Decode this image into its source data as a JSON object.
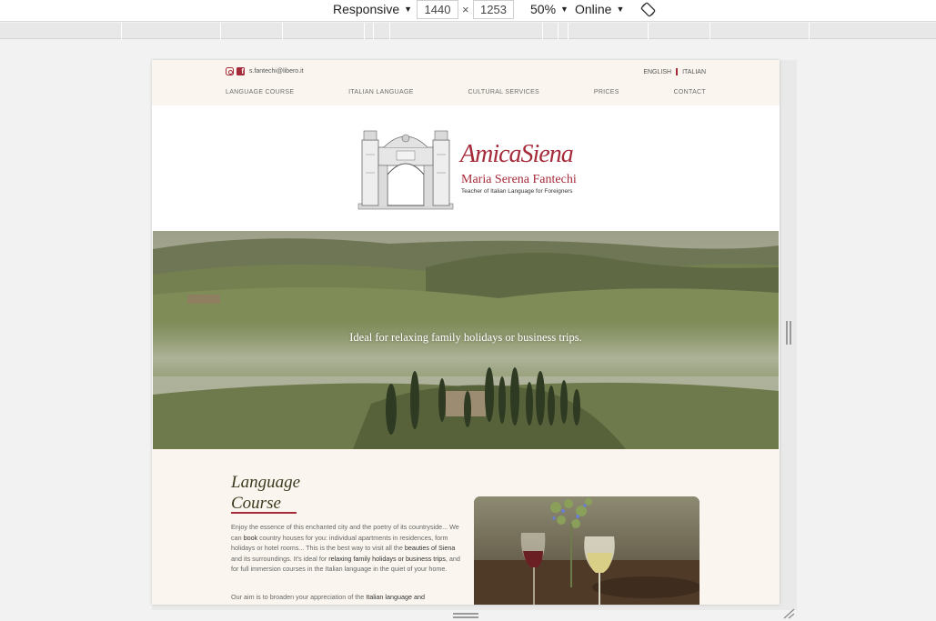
{
  "devtools": {
    "device_mode": "Responsive",
    "width": "1440",
    "times": "×",
    "height": "1253",
    "zoom": "50%",
    "network": "Online",
    "dropdown_glyph": "▼"
  },
  "site": {
    "email": "s.fantechi@libero.it",
    "lang_english": "ENGLISH",
    "lang_italian": "ITALIAN",
    "nav": [
      "LANGUAGE COURSE",
      "ITALIAN LANGUAGE",
      "CULTURAL SERVICES",
      "PRICES",
      "CONTACT"
    ],
    "logo_title": "AmicaSiena",
    "logo_name": "Maria Serena Fantechi",
    "logo_sub": "Teacher of Italian Language for Foreigners",
    "hero_text": "Ideal for relaxing family holidays or business trips.",
    "section_title_1": "Language",
    "section_title_2": "Course",
    "para1": {
      "t1": "Enjoy the essence of this enchanted city and the poetry of its countryside... We can ",
      "b1": "book",
      "t2": " country houses for you: individual apartments in residences, form holidays or hotel rooms... This is the best way to visit all the ",
      "b2": "beauties of Siena",
      "t3": " and its surroundings. It's ideal for ",
      "b3": "relaxing family holidays or business trips",
      "t4": ", and for full immersion courses in the Italian language in the quiet of your home."
    },
    "para2": {
      "t1": "Our aim is to broaden your appreciation of the ",
      "b1": "Italian language and"
    }
  },
  "colors": {
    "accent": "#a52a3a",
    "band": "#faf6ef"
  }
}
